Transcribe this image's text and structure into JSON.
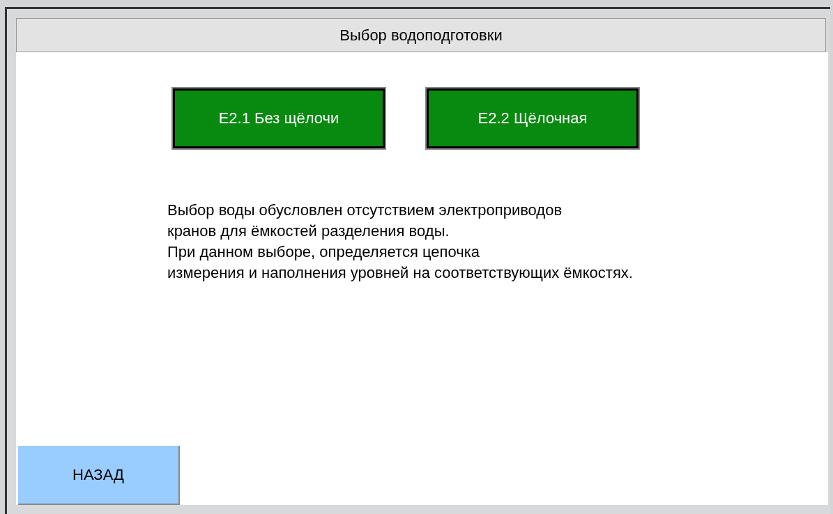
{
  "window": {
    "title": "Выбор водоподготовки"
  },
  "options": [
    {
      "label": "E2.1 Без щёлочи"
    },
    {
      "label": "E2.2 Щёлочная"
    }
  ],
  "description": [
    "Выбор воды обусловлен отсутствием электроприводов",
    "кранов для ёмкостей разделения воды.",
    "При данном выборе, определяется цепочка",
    "измерения и наполнения уровней на соответствующих ёмкостях."
  ],
  "back_button": {
    "label": "НАЗАД"
  }
}
